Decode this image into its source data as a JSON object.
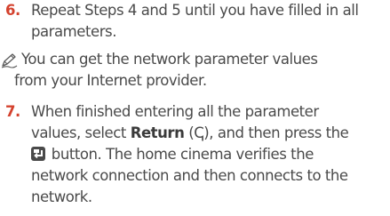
{
  "step6": {
    "number": "6.",
    "line1": "Repeat Steps 4 and 5 until you have filled in all",
    "line2": "parameters."
  },
  "note": {
    "icon": "pencil-note-icon",
    "line1": "You can get the network parameter values",
    "line2": "from your Internet provider."
  },
  "step7": {
    "number": "7.",
    "line1": "When finished entering all the parameter",
    "line2_pre": "values, select ",
    "return_label": "Return",
    "return_open": " (",
    "return_glyph": "ↅ",
    "return_close": "), and then press the",
    "enter_icon": "enter-button-icon",
    "line3_post": " button. The home cinema verifies the",
    "line4": "network connection and then connects to the",
    "line5": "network."
  },
  "colors": {
    "step_number": "#d4422e",
    "body_text": "#4a4a4a"
  }
}
